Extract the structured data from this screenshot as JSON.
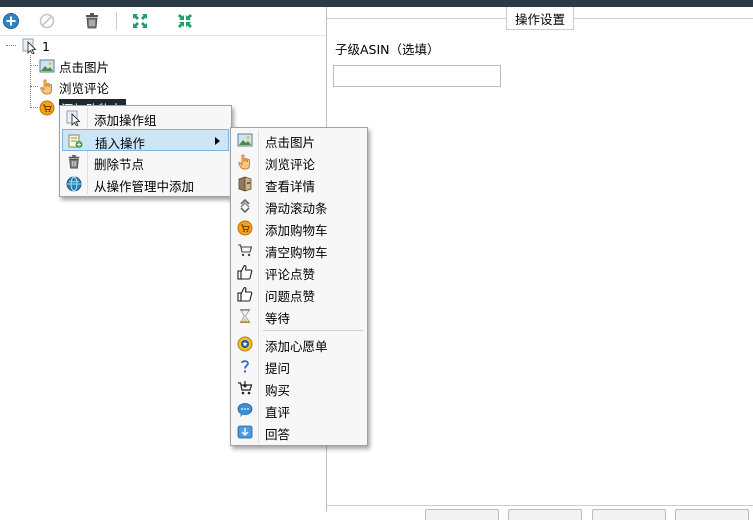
{
  "tree": {
    "root_label": "1",
    "children": [
      {
        "label": "点击图片",
        "icon": "picture-icon"
      },
      {
        "label": "浏览评论",
        "icon": "hand-pointer-icon"
      },
      {
        "label": "添加购物车",
        "icon": "add-cart-icon"
      }
    ]
  },
  "context_menu": {
    "items": [
      {
        "label": "添加操作组",
        "icon": "cursor-icon"
      },
      {
        "label": "插入操作",
        "icon": "insert-icon"
      },
      {
        "label": "删除节点",
        "icon": "trash-icon"
      },
      {
        "label": "从操作管理中添加",
        "icon": "globe-icon"
      }
    ]
  },
  "submenu": {
    "items": [
      {
        "label": "点击图片",
        "icon": "picture-icon"
      },
      {
        "label": "浏览评论",
        "icon": "hand-pointer-icon"
      },
      {
        "label": "查看详情",
        "icon": "details-icon"
      },
      {
        "label": "滑动滚动条",
        "icon": "scroll-icon"
      },
      {
        "label": "添加购物车",
        "icon": "add-cart-icon"
      },
      {
        "label": "清空购物车",
        "icon": "empty-cart-icon"
      },
      {
        "label": "评论点赞",
        "icon": "thumbs-up-icon"
      },
      {
        "label": "问题点赞",
        "icon": "thumbs-up-icon"
      },
      {
        "label": "等待",
        "icon": "hourglass-icon"
      },
      {
        "label": "添加心愿单",
        "icon": "wishlist-icon"
      },
      {
        "label": "提问",
        "icon": "question-icon"
      },
      {
        "label": "购买",
        "icon": "buy-cart-icon"
      },
      {
        "label": "直评",
        "icon": "comment-icon"
      },
      {
        "label": "回答",
        "icon": "answer-icon"
      }
    ]
  },
  "settings": {
    "group_title": "操作设置",
    "field_label": "子级ASIN（选填）",
    "field_value": "",
    "field_placeholder": ""
  }
}
